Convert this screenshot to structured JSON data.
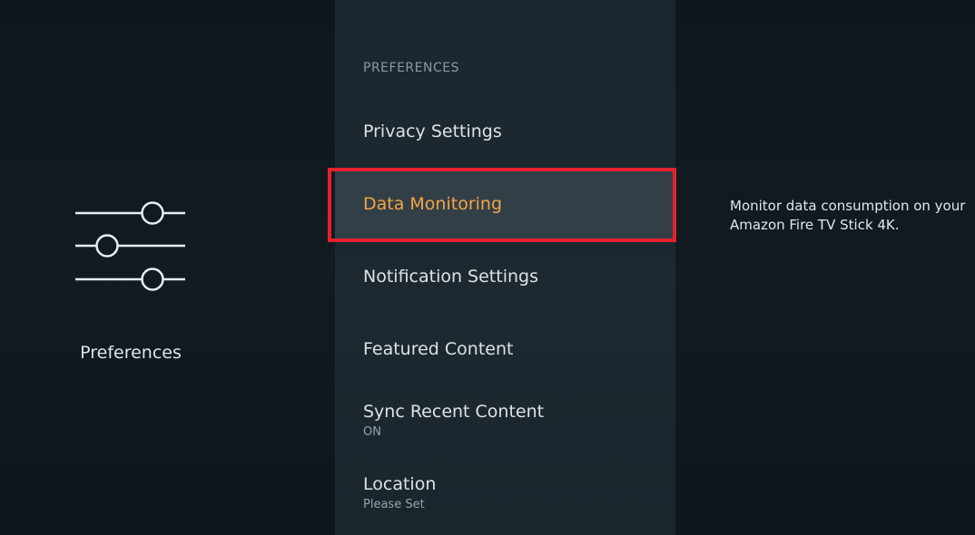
{
  "left_panel": {
    "icon": "sliders-icon",
    "title": "Preferences"
  },
  "menu": {
    "header": "PREFERENCES",
    "items": [
      {
        "label": "Privacy Settings"
      },
      {
        "label": "Data Monitoring",
        "selected": true
      },
      {
        "label": "Notification Settings"
      },
      {
        "label": "Featured Content"
      },
      {
        "label": "Sync Recent Content",
        "sub": "ON"
      },
      {
        "label": "Location",
        "sub": "Please Set"
      }
    ]
  },
  "description": {
    "text": "Monitor data consumption on your Amazon Fire TV Stick 4K."
  },
  "colors": {
    "selected_text": "#f2a545",
    "highlight_frame": "#e3222d",
    "menu_background": "#1d2830",
    "selected_background": "#333f47"
  }
}
